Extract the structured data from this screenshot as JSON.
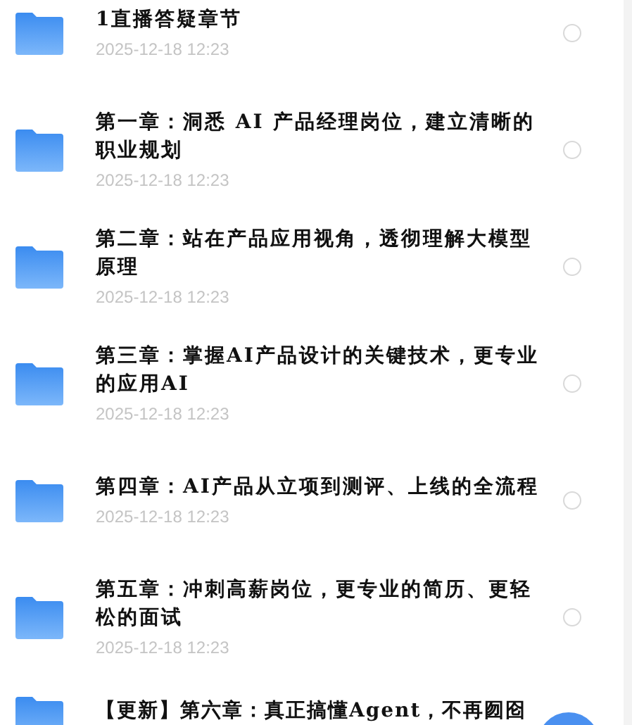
{
  "items": [
    {
      "title": "1直播答疑章节",
      "date": "2025-12-18 12:23",
      "selected": false
    },
    {
      "title": "第一章：洞悉 AI 产品经理岗位，建立清晰的职业规划",
      "date": "2025-12-18 12:23",
      "selected": false
    },
    {
      "title": "第二章：站在产品应用视角，透彻理解大模型原理",
      "date": "2025-12-18 12:23",
      "selected": false
    },
    {
      "title": "第三章：掌握AI产品设计的关键技术，更专业的应用AI",
      "date": "2025-12-18 12:23",
      "selected": false
    },
    {
      "title": "第四章：AI产品从立项到测评、上线的全流程",
      "date": "2025-12-18 12:23",
      "selected": false
    },
    {
      "title": "第五章：冲刺高薪岗位，更专业的简历、更轻松的面试",
      "date": "2025-12-18 12:23",
      "selected": false
    },
    {
      "title": "【更新】第六章：真正搞懂Agent，不再囫囵"
    }
  ]
}
